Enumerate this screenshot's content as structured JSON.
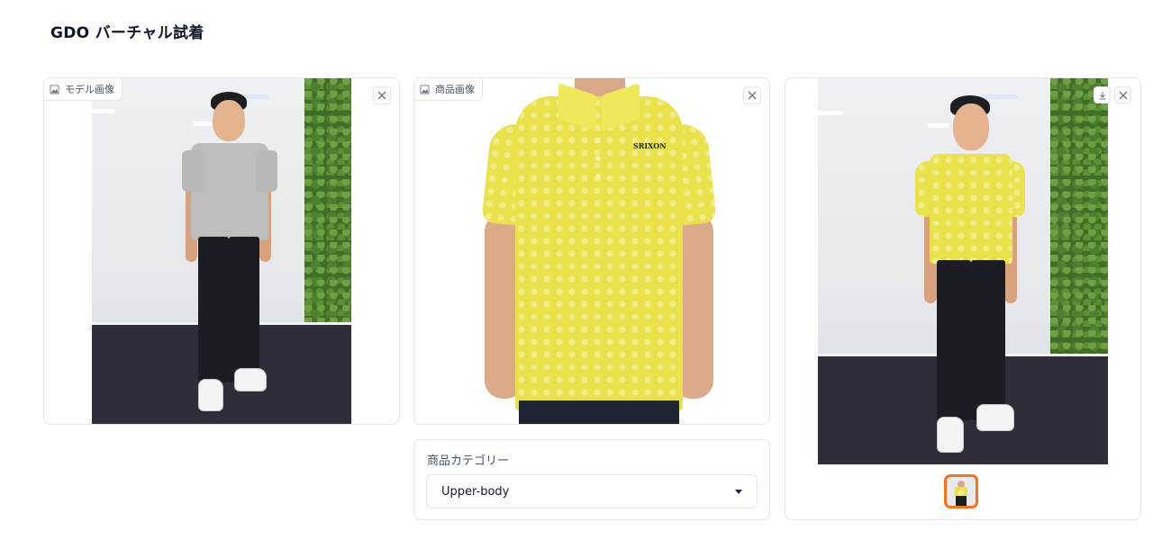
{
  "app": {
    "title": "GDO バーチャル試着"
  },
  "panels": {
    "model": {
      "label": "モデル画像",
      "icon": "image-icon",
      "close_icon": "close-icon"
    },
    "product": {
      "label": "商品画像",
      "icon": "image-icon",
      "close_icon": "close-icon",
      "brand_logo_text": "SRIXON"
    },
    "result": {
      "download_icon": "download-icon",
      "close_icon": "close-icon"
    }
  },
  "category": {
    "label": "商品カテゴリー",
    "selected": "Upper-body"
  },
  "colors": {
    "accent": "#f97316",
    "shirt_yellow": "#e9e24a",
    "border": "#e5e7eb"
  }
}
